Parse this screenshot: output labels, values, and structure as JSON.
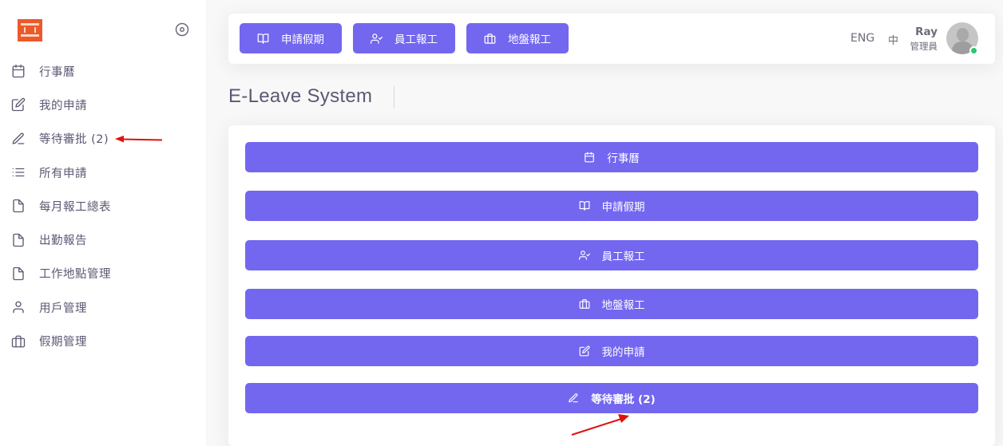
{
  "sidebar": {
    "items": [
      {
        "label": "行事曆",
        "icon": "calendar-icon"
      },
      {
        "label": "我的申請",
        "icon": "edit-icon"
      },
      {
        "label": "等待審批 (2)",
        "icon": "pen-icon"
      },
      {
        "label": "所有申請",
        "icon": "list-icon"
      },
      {
        "label": "每月報工總表",
        "icon": "file-icon"
      },
      {
        "label": "出勤報告",
        "icon": "file-icon"
      },
      {
        "label": "工作地點管理",
        "icon": "file-icon"
      },
      {
        "label": "用戶管理",
        "icon": "user-icon"
      },
      {
        "label": "假期管理",
        "icon": "briefcase-icon"
      }
    ]
  },
  "navbar": {
    "buttons": [
      {
        "label": "申請假期",
        "icon": "book-open-icon"
      },
      {
        "label": "員工報工",
        "icon": "user-check-icon"
      },
      {
        "label": "地盤報工",
        "icon": "briefcase-icon"
      }
    ],
    "lang_eng": "ENG",
    "lang_zh": "中",
    "user_name": "Ray",
    "user_role": "管理員"
  },
  "page": {
    "title": "E-Leave System"
  },
  "quick_actions": [
    {
      "label": "行事曆",
      "icon": "calendar-icon"
    },
    {
      "label": "申請假期",
      "icon": "book-open-icon"
    },
    {
      "label": "員工報工",
      "icon": "user-check-icon"
    },
    {
      "label": "地盤報工",
      "icon": "briefcase-icon"
    },
    {
      "label": "我的申請",
      "icon": "edit-icon"
    },
    {
      "label": "等待審批 (2)",
      "icon": "pen-icon"
    }
  ],
  "colors": {
    "accent": "#7367f0",
    "logo": "#ea5a2a",
    "annotation_arrow": "#e01010",
    "online_status": "#28c76f"
  }
}
